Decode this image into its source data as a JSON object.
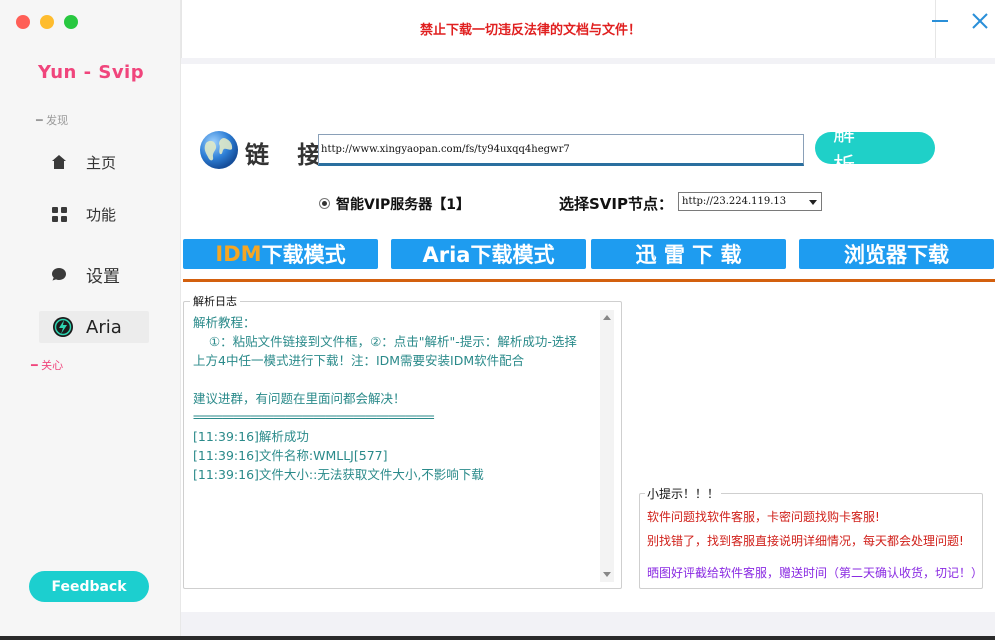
{
  "sidebar": {
    "brand": "Yun - Svip",
    "section_discover": "━ 发现",
    "section_care": "━ 关心",
    "items": [
      {
        "label": "主页",
        "icon": "home-icon"
      },
      {
        "label": "功能",
        "icon": "grid-icon"
      },
      {
        "label": "设置",
        "icon": "chat-bubble-icon"
      },
      {
        "label": "Aria",
        "icon": "aria-logo-icon"
      }
    ],
    "feedback_label": "Feedback"
  },
  "header": {
    "warning": "禁止下载一切违反法律的文档与文件！"
  },
  "link": {
    "label": "链 接:",
    "url": "http://www.xingyaopan.com/fs/ty94uxqq4hegwr7",
    "parse_label": "解 析"
  },
  "server": {
    "radio_label": "智能VIP服务器【1】",
    "node_label": "选择SVIP节点：",
    "node_value": "http://23.224.119.13"
  },
  "modes": {
    "idm_prefix": "IDM",
    "idm_suffix": "下载模式",
    "aria": "Aria下载模式",
    "thunder": "迅 雷 下 载",
    "browser": "浏览器下载"
  },
  "log": {
    "title": "解析日志",
    "lines": [
      "解析教程：",
      "    ①：粘贴文件链接到文件框，②：点击\"解析\"-提示：解析成功-选择",
      "上方4中任一模式进行下载！注：IDM需要安装IDM软件配合",
      "",
      "建议进群，有问题在里面问都会解决！",
      "==========================================",
      "[11:39:16]解析成功",
      "[11:39:16]文件名称:WMLLJ[577]",
      "[11:39:16]文件大小::无法获取文件大小,不影响下载"
    ]
  },
  "tips": {
    "title": "小提示！！！",
    "line1": "软件问题找软件客服，卡密问题找购卡客服!",
    "line2": "别找错了，找到客服直接说明详细情况，每天都会处理问题!",
    "line3": "晒图好评截给软件客服，赠送时间（第二天确认收货，切记！）",
    "color_red": "#d0201a",
    "color_purple": "#8a2be2"
  }
}
